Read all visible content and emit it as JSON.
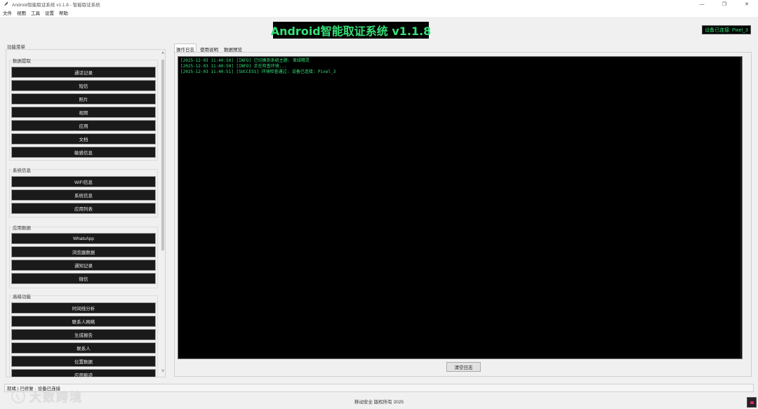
{
  "window": {
    "title": "Android智能取证系统 v1.1.8 - 智能取证系统",
    "controls": [
      "—",
      "❐",
      "✕"
    ]
  },
  "menu": [
    "文件",
    "视图",
    "工具",
    "设置",
    "帮助"
  ],
  "header": {
    "title": "Android智能取证系统 v1.1.8",
    "device_status": "设备已连接: Pixel_3",
    "accent_color": "#34e078"
  },
  "left_panel": {
    "title": "功能菜单",
    "groups": [
      {
        "label": "数据提取",
        "buttons": [
          "通话记录",
          "短信",
          "照片",
          "视频",
          "应用",
          "文档",
          "敏感信息"
        ]
      },
      {
        "label": "系统信息",
        "buttons": [
          "WiFi信息",
          "系统信息",
          "应用列表"
        ]
      },
      {
        "label": "应用数据",
        "buttons": [
          "WhatsApp",
          "浏览器数据",
          "通知记录",
          "微信"
        ]
      },
      {
        "label": "高级功能",
        "buttons": [
          "时间线分析",
          "联系人网络",
          "生成报告",
          "联系人",
          "位置数据",
          "应用痕迹"
        ]
      }
    ]
  },
  "tabs": [
    "操作日志",
    "使用说明",
    "数据预览"
  ],
  "log": {
    "lines": [
      "[2025-12-03 11:40:50] [INFO] 已切换到系统主题: 草绿精灵",
      "[2025-12-03 11:40:50] [INFO] 正在检查环境...",
      "[2025-12-03 11:40:51] [SUCCESS] 环境检查通过: 设备已连接: Pixel_3"
    ],
    "clear_button": "清空日志"
  },
  "status_bar": "就绪 | 已修复 · 设备已连接",
  "footer": "移动安全 版权所有 2025",
  "watermark": "大数跨境"
}
